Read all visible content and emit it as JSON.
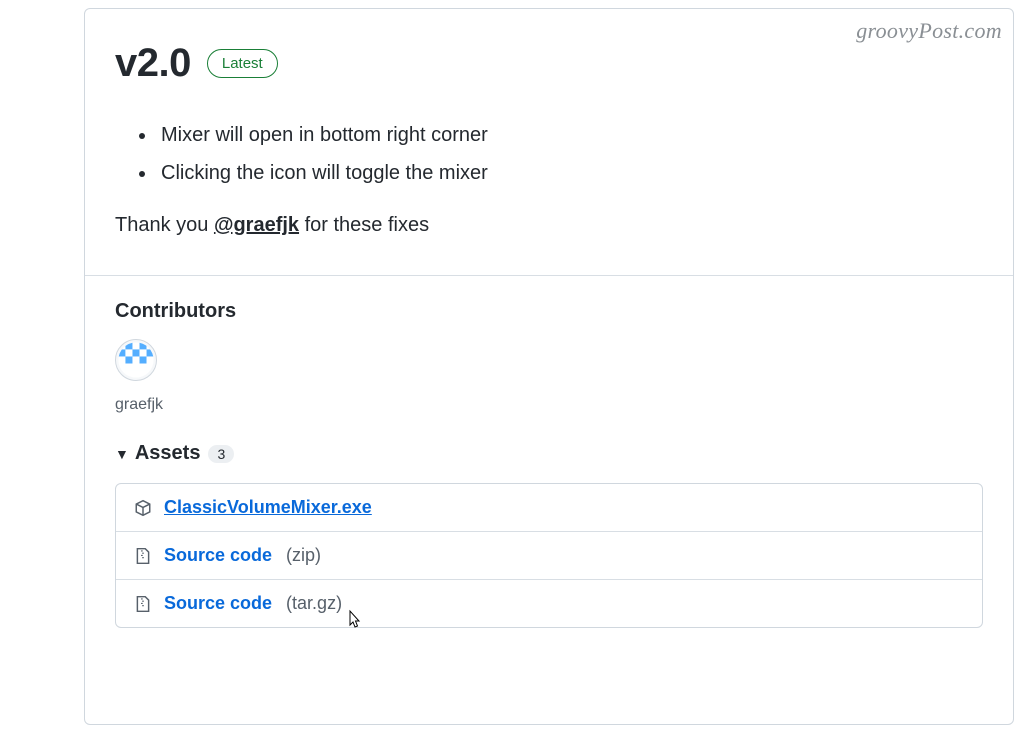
{
  "watermark": "groovyPost.com",
  "release": {
    "version": "v2.0",
    "badge": "Latest",
    "changes": [
      "Mixer will open in bottom right corner",
      "Clicking the icon will toggle the mixer"
    ],
    "thanks_prefix": "Thank you ",
    "thanks_mention": "@graefjk",
    "thanks_suffix": " for these fixes"
  },
  "contributors": {
    "heading": "Contributors",
    "items": [
      {
        "name": "graefjk"
      }
    ]
  },
  "assets": {
    "heading": "Assets",
    "count": "3",
    "items": [
      {
        "kind": "package",
        "label": "ClassicVolumeMixer.exe",
        "suffix": "",
        "hovered": true
      },
      {
        "kind": "zip",
        "label": "Source code",
        "suffix": "(zip)"
      },
      {
        "kind": "zip",
        "label": "Source code",
        "suffix": "(tar.gz)"
      }
    ]
  }
}
